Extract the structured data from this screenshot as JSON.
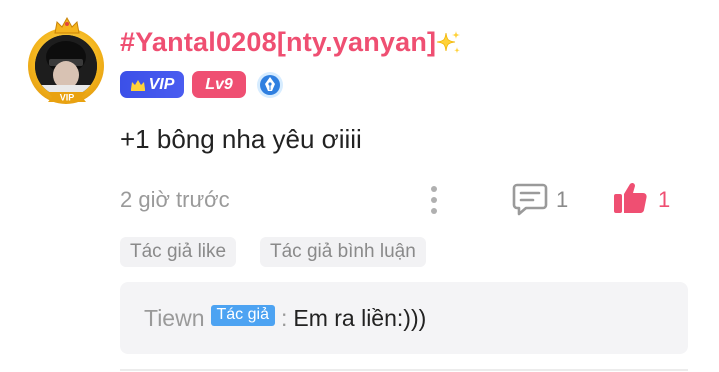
{
  "comment": {
    "username": "#Yantal0208[nty.yanyan]",
    "avatar_badge": "VIP",
    "badges": {
      "vip_label": "VIP",
      "level_label": "Lv9",
      "pen_badge_icon": "pen-nib-icon"
    },
    "content": "+1 bông nha yêu ơiiii",
    "time": "2 giờ trước",
    "reply_count": "1",
    "like_count": "1",
    "tags": [
      "Tác giả like",
      "Tác giả bình luận"
    ],
    "reply": {
      "author": "Tiewn",
      "author_tag": "Tác giả",
      "separator": ":",
      "text": "Em ra liền:)))"
    }
  },
  "colors": {
    "username": "#ef4f72",
    "vip_badge": "#3b50e8",
    "level_badge": "#ef4f72",
    "like_active": "#ef4f72",
    "author_tag": "#4da3f2"
  }
}
